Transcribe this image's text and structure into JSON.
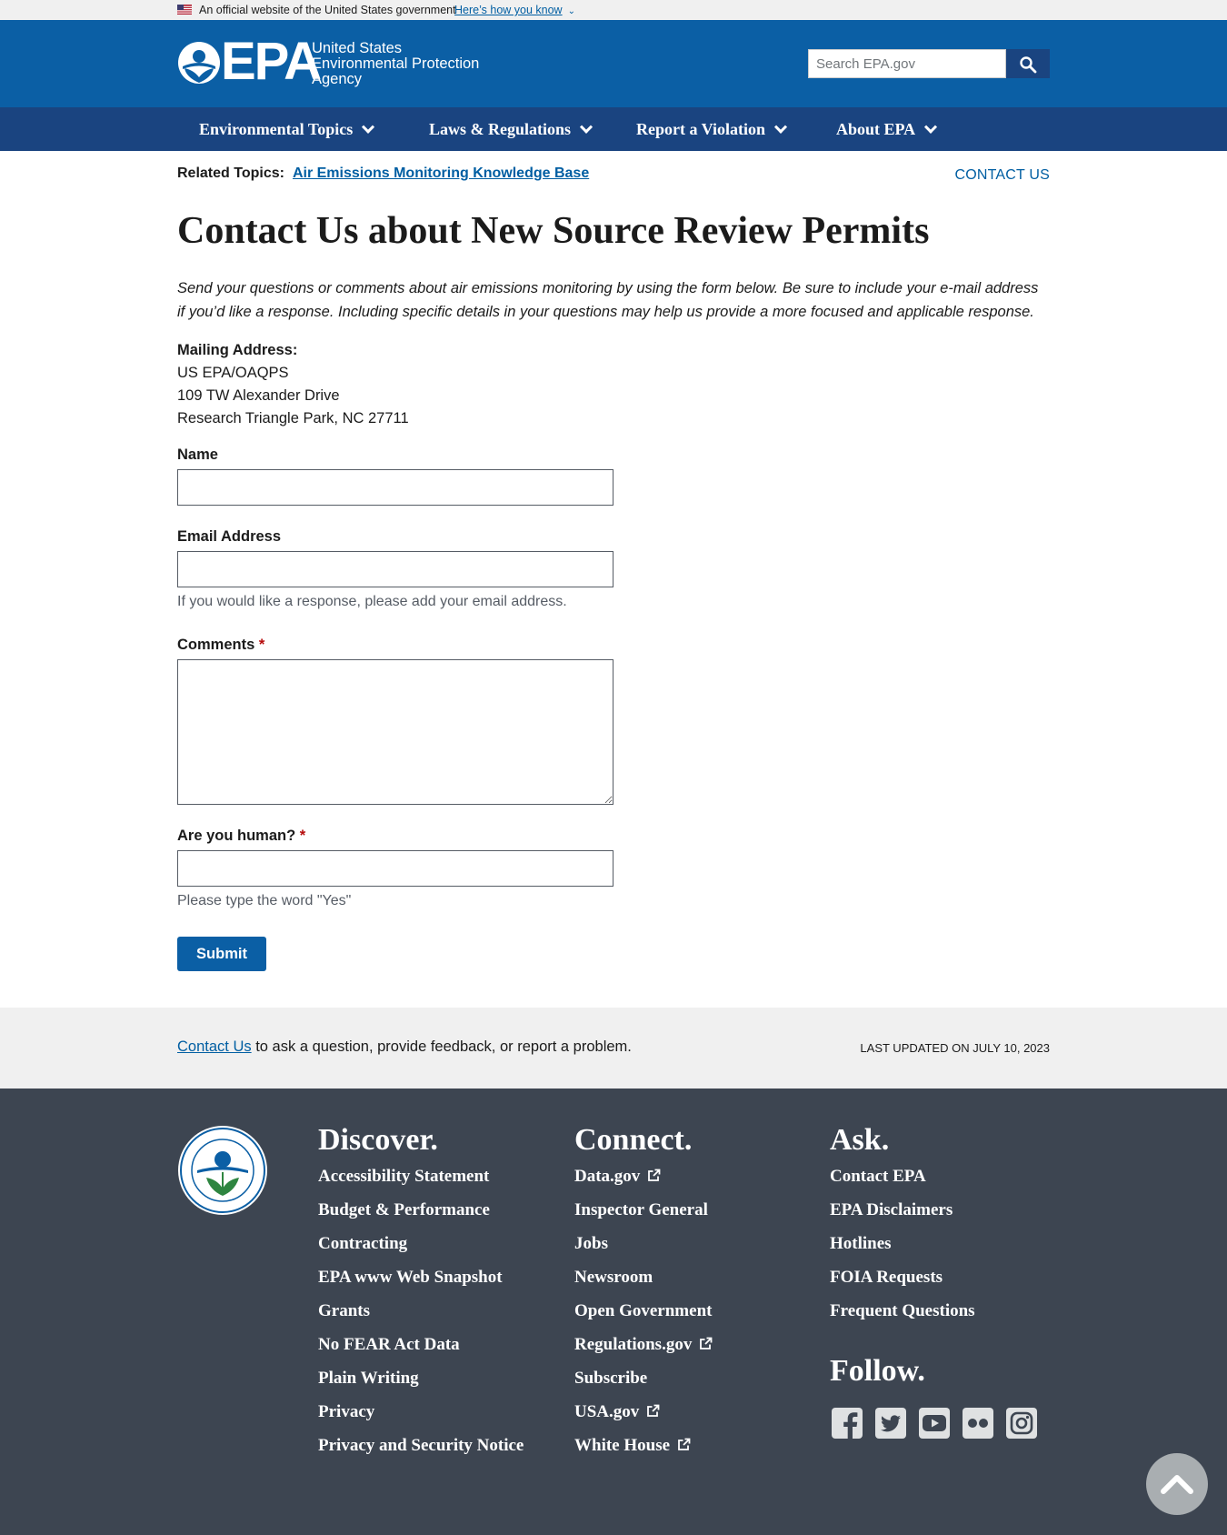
{
  "gov_banner": {
    "text": "An official website of the United States government",
    "link": "Here’s how you know"
  },
  "header": {
    "logo_text": "EPA",
    "agency_lines": [
      "United States",
      "Environmental Protection",
      "Agency"
    ],
    "search_placeholder": "Search EPA.gov",
    "search_icon": "search-icon"
  },
  "nav": {
    "items": [
      {
        "label": "Environmental Topics"
      },
      {
        "label": "Laws & Regulations"
      },
      {
        "label": "Report a Violation"
      },
      {
        "label": "About EPA"
      }
    ]
  },
  "main": {
    "related_label": "Related Topics:",
    "related_link": "Air Emissions Monitoring Knowledge Base",
    "contact_us": "CONTACT US",
    "title": "Contact Us about New Source Review Permits",
    "intro": "Send your questions or comments about air emissions monitoring by using the form below. Be sure to include your e-mail address if you’d like a response.  Including specific details in your questions may help us provide a more focused and applicable response.",
    "mailing_heading": "Mailing Address:",
    "mailing_lines": [
      "US EPA/OAQPS",
      "109 TW Alexander Drive",
      "Research Triangle Park, NC 27711"
    ]
  },
  "form": {
    "name_label": "Name",
    "name_value": "",
    "email_label": "Email Address",
    "email_value": "",
    "email_hint": "If you would like a response, please add your email address.",
    "comments_label": "Comments",
    "comments_value": "",
    "human_label": "Are you human?",
    "human_value": "",
    "human_hint": "Please type the word \"Yes\"",
    "required_mark": "*",
    "submit_label": "Submit"
  },
  "prefooter": {
    "link": "Contact Us",
    "text": " to ask a question, provide feedback, or report a problem.",
    "last_updated": "LAST UPDATED ON JULY 10, 2023"
  },
  "footer": {
    "discover": {
      "heading": "Discover.",
      "items": [
        "Accessibility Statement",
        "Budget & Performance",
        "Contracting",
        "EPA www Web Snapshot",
        "Grants",
        "No FEAR Act Data",
        "Plain Writing",
        "Privacy",
        "Privacy and Security Notice"
      ]
    },
    "connect": {
      "heading": "Connect.",
      "items": [
        "Data.gov",
        "Inspector General",
        "Jobs",
        "Newsroom",
        "Open Government",
        "Regulations.gov",
        "Subscribe",
        "USA.gov",
        "White House"
      ]
    },
    "ask": {
      "heading": "Ask.",
      "items": [
        "Contact EPA",
        "EPA Disclaimers",
        "Hotlines",
        "FOIA Requests",
        "Frequent Questions"
      ]
    },
    "follow_heading": "Follow.",
    "social_icons": [
      "facebook-icon",
      "twitter-icon",
      "youtube-icon",
      "flickr-icon",
      "instagram-icon"
    ]
  },
  "colors": {
    "header_blue": "#0b5fa5",
    "nav_blue": "#1a4480",
    "link_blue": "#005ea2",
    "footer_gray": "#3d4551",
    "prefooter_gray": "#f0f0f0",
    "required_red": "#b50909"
  }
}
